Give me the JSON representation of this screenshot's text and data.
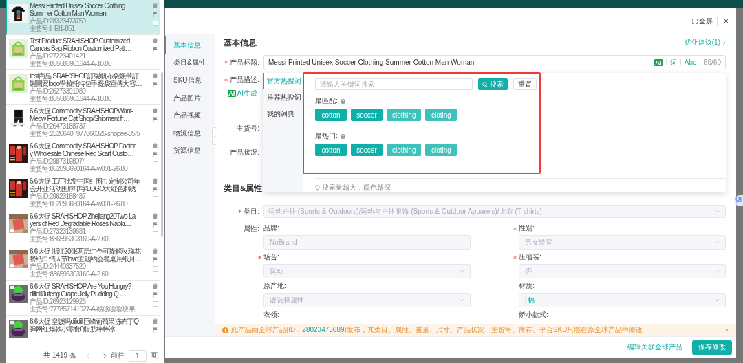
{
  "product_list": {
    "items": [
      {
        "title_lines": [
          "Messi Printed Unisex Soccer Clothing",
          "Summer Cotton Man Woman"
        ],
        "product_id": "产品ID:28323473750",
        "sku": "主货号:HEI1-851",
        "selected": true,
        "checked": false
      },
      {
        "title_lines": [
          "Test Product SRAH'SHOP Customized",
          "Canvas Bag Ribbon Customized Patt…"
        ],
        "product_id": "产品ID:27223401421",
        "sku": "主货号:855586901644-A-10.00",
        "selected": false,
        "checked": false
      },
      {
        "title_lines": [
          "test商品 SRAH'SHOP訂製帆布袋飄帶訂",
          "製圖案logo學校托特包手提袋宣傳大容…"
        ],
        "product_id": "产品ID:26273391989",
        "sku": "主货号:855586901644-A-10.00",
        "selected": false,
        "checked": false
      },
      {
        "title_lines": [
          "6.6大促 Commodity SRAH'SHOPWant-",
          "Meow Fortune Cat Shop/Shipment fr…"
        ],
        "product_id": "产品ID:26473188737",
        "sku": "主货号:2320640_977860326-shopee-85.5",
        "selected": false,
        "checked": false
      },
      {
        "title_lines": [
          "6.6大促 Commodity SRAH'SHOP Factor",
          "y Wholesale Chinese Red Scarf Custo…"
        ],
        "product_id": "产品ID:29873198074",
        "sku": "主货号:862893690164-A-w001-26.80",
        "selected": false,
        "checked": false
      },
      {
        "title_lines": [
          "6.6大促 工厂批发中国红围巾定制公司年",
          "会开业活动围脖印字LOGO大红色刺绣"
        ],
        "product_id": "产品ID:29623188487",
        "sku": "主货号:862893690164-A-w001-26.80",
        "selected": false,
        "checked": false
      },
      {
        "title_lines": [
          "6.6大促 SRAH'SHOP Zhejiang20Two La",
          "yers of Red Degradable Roses Napki…"
        ],
        "product_id": "产品ID:27323139681",
        "sku": "主货号:836596303169-A-2.60",
        "selected": false,
        "checked": false
      },
      {
        "title_lines": [
          "6.6大促 浙江20张两层红色可降解玫瑰花",
          "餐纸巾情人节love主题约会餐桌用纸月…"
        ],
        "product_id": "产品ID:24440337520",
        "sku": "主货号:836596303169-A-2.60",
        "selected": false,
        "checked": false
      },
      {
        "title_lines": [
          "6.6大促 SRAH'SHOP Are You Hungry?",
          "dilidiliJufeng Grape Jelly Pudding Q …"
        ],
        "product_id": "产品ID:26923129926",
        "sku": "主货号:777857141027-A-嗖嗖嗖嗖嗖果…",
        "selected": false,
        "checked": false
      },
      {
        "title_lines": [
          "6.6大促 皇饭吗dilidili巨峰葡萄果冻布丁Q",
          "弹网红爆款小零食0脂肪棒棒冰"
        ],
        "selected": false
      }
    ],
    "pagination": {
      "total": "共 1419 条",
      "goto_label": "前往",
      "page": "1",
      "page_suffix": "页"
    }
  },
  "dialog": {
    "fullscreen": "全屏"
  },
  "nav": [
    {
      "label": "基本信息",
      "selected": true
    },
    {
      "label": "类目&属性",
      "selected": false
    },
    {
      "label": "SKU信息",
      "selected": false
    },
    {
      "label": "产品图片",
      "selected": false
    },
    {
      "label": "产品视频",
      "selected": false
    },
    {
      "label": "物流信息",
      "selected": false
    },
    {
      "label": "货源信息",
      "selected": false
    }
  ],
  "basic_info": {
    "heading": "基本信息",
    "suggestion": "优化建议(1)",
    "title_label": "产品标题:",
    "title_required": true,
    "title_value": "Messi Printed Unisex Soccer Clothing Summer Cotton Man Woman",
    "title_ai": "AI",
    "title_word": "词",
    "title_case": "Abc",
    "title_count": "60/60",
    "desc_label": "产品描述:",
    "desc_required": true,
    "ai_badge": "AI",
    "ai_generate": "AI生成",
    "sku_label": "主货号:",
    "condition_label": "产品状况:"
  },
  "keyword_popover": {
    "tabs": [
      {
        "label": "官方热搜词",
        "selected": true
      },
      {
        "label": "推荐热搜词",
        "selected": false
      },
      {
        "label": "我的词典",
        "selected": false
      }
    ],
    "search_placeholder": "请输入关键词搜索",
    "search_button": "搜索",
    "reset_button": "重置",
    "groups": [
      {
        "label": "最匹配:",
        "tags": [
          {
            "text": "cotton",
            "color": "#10b0aa"
          },
          {
            "text": "soccer",
            "color": "#10b0aa"
          },
          {
            "text": "clothing",
            "color": "#3cc1bb"
          },
          {
            "text": "cloting",
            "color": "#3cc1bb"
          }
        ]
      },
      {
        "label": "最热门:",
        "tags": [
          {
            "text": "cotton",
            "color": "#10b0aa"
          },
          {
            "text": "soccer",
            "color": "#10b0aa"
          },
          {
            "text": "clothing",
            "color": "#3cc1bb"
          },
          {
            "text": "cloting",
            "color": "#3cc1bb"
          }
        ]
      }
    ],
    "hint": "搜索量越大，颜色越深"
  },
  "category_attributes": {
    "heading": "类目&属性",
    "category_label": "类目:",
    "category_required": true,
    "category_value": "运动户外 (Sports & Outdoors)/运动与户外服饰 (Sports & Outdoor Apparels)/上衣 (T-shirts)",
    "attributes_label": "属性:",
    "fields": [
      {
        "label": "品牌:",
        "required": false,
        "kind": "input",
        "value": "NoBrand"
      },
      {
        "label": "性别:",
        "required": true,
        "kind": "select",
        "value": "男女皆宜"
      },
      {
        "label": "场合:",
        "required": true,
        "kind": "select",
        "value": "运动"
      },
      {
        "label": "压缩装:",
        "required": true,
        "kind": "select",
        "value": "否"
      },
      {
        "label": "原产地:",
        "required": false,
        "kind": "select",
        "placeholder": "请选择属性"
      },
      {
        "label": "材质:",
        "required": false,
        "kind": "tags",
        "tags": [
          "棉"
        ]
      },
      {
        "label": "衣领:",
        "required": false,
        "kind": "label"
      },
      {
        "label": "娇小款式:",
        "required": false,
        "kind": "label"
      }
    ]
  },
  "notice": {
    "before": "此产品由全球产品(ID：",
    "id": "28023473689",
    "after": ")发布，其类目、属性、重量、尺寸、产品状况、主货号、库存、平台SKU只能在原全球产品中修改"
  },
  "footer": {
    "link": "编辑关联全球产品",
    "save": "保存修改"
  },
  "translate_badge": "译"
}
